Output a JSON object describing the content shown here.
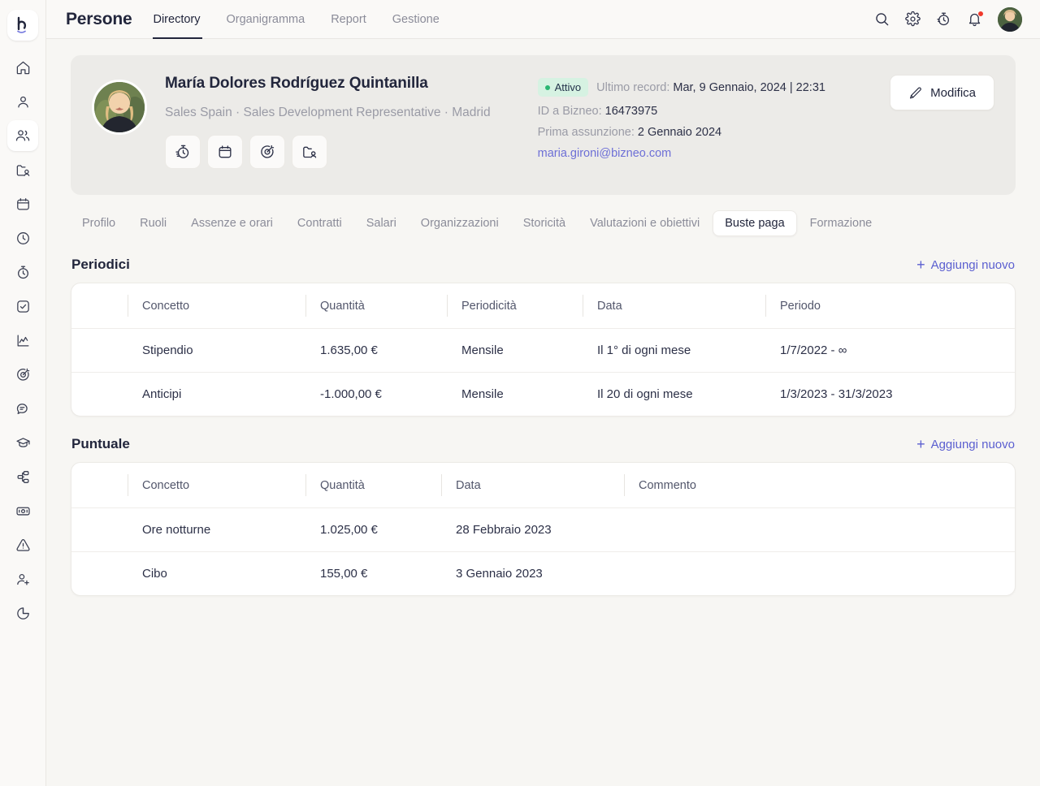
{
  "rail": {
    "logo": "bizneo-logo",
    "items": [
      {
        "name": "home-icon",
        "label": "Home",
        "active": false
      },
      {
        "name": "user-icon",
        "label": "Profilo",
        "active": false
      },
      {
        "name": "people-icon",
        "label": "Persone",
        "active": true
      },
      {
        "name": "folder-user-icon",
        "label": "Documenti",
        "active": false
      },
      {
        "name": "calendar-icon",
        "label": "Calendario",
        "active": false
      },
      {
        "name": "clock-icon",
        "label": "Orari",
        "active": false
      },
      {
        "name": "stopwatch-icon",
        "label": "Presenze",
        "active": false
      },
      {
        "name": "check-square-icon",
        "label": "Attivita",
        "active": false
      },
      {
        "name": "chart-line-icon",
        "label": "Analisi",
        "active": false
      },
      {
        "name": "target-icon",
        "label": "Obiettivi",
        "active": false
      },
      {
        "name": "chat-icon",
        "label": "Messaggi",
        "active": false
      },
      {
        "name": "graduation-cap-icon",
        "label": "Formazione",
        "active": false
      },
      {
        "name": "workflow-icon",
        "label": "Flussi",
        "active": false
      },
      {
        "name": "money-icon",
        "label": "Retribuzioni",
        "active": false
      },
      {
        "name": "alert-triangle-icon",
        "label": "Incidenti",
        "active": false
      },
      {
        "name": "user-plus-icon",
        "label": "Selezione",
        "active": false
      },
      {
        "name": "pie-chart-icon",
        "label": "Report",
        "active": false
      }
    ]
  },
  "header": {
    "app_title": "Persone",
    "nav": [
      {
        "label": "Directory",
        "active": true
      },
      {
        "label": "Organigramma",
        "active": false
      },
      {
        "label": "Report",
        "active": false
      },
      {
        "label": "Gestione",
        "active": false
      }
    ],
    "icons": [
      {
        "name": "search-icon"
      },
      {
        "name": "gear-icon"
      },
      {
        "name": "stopwatch-icon"
      },
      {
        "name": "bell-icon"
      }
    ],
    "avatar_alt": "Foto profilo utente"
  },
  "profile": {
    "name": "María Dolores Rodríguez Quintanilla",
    "subtitle": "Sales Spain · Sales Development Representative · Madrid",
    "avatar_alt": "Foto di María Dolores Rodríguez Quintanilla",
    "quick_actions": [
      {
        "name": "stopwatch-icon"
      },
      {
        "name": "calendar-icon"
      },
      {
        "name": "target-icon"
      },
      {
        "name": "folder-user-icon"
      }
    ],
    "status": "Attivo",
    "last_record_label": "Ultimo record:",
    "last_record_value": "Mar, 9 Gennaio, 2024 | 22:31",
    "bizneo_id_label": "ID a Bizneo:",
    "bizneo_id_value": "16473975",
    "first_hire_label": "Prima assunzione:",
    "first_hire_value": "2 Gennaio 2024",
    "email": "maria.gironi@bizneo.com",
    "edit_label": "Modifica"
  },
  "section_tabs": [
    {
      "label": "Profilo",
      "active": false
    },
    {
      "label": "Ruoli",
      "active": false
    },
    {
      "label": "Assenze e orari",
      "active": false
    },
    {
      "label": "Contratti",
      "active": false
    },
    {
      "label": "Salari",
      "active": false
    },
    {
      "label": "Organizzazioni",
      "active": false
    },
    {
      "label": "Storicità",
      "active": false
    },
    {
      "label": "Valutazioni e obiettivi",
      "active": false
    },
    {
      "label": "Buste paga",
      "active": true
    },
    {
      "label": "Formazione",
      "active": false
    }
  ],
  "periodici": {
    "title": "Periodici",
    "add_label": "Aggiungi nuovo",
    "columns": [
      "Concetto",
      "Quantità",
      "Periodicità",
      "Data",
      "Periodo"
    ],
    "rows": [
      {
        "concetto": "Stipendio",
        "quantita": "1.635,00 €",
        "periodicita": "Mensile",
        "data": "Il 1° di ogni mese",
        "periodo": "1/7/2022 - ∞"
      },
      {
        "concetto": "Anticipi",
        "quantita": "-1.000,00 €",
        "periodicita": "Mensile",
        "data": "Il 20 di ogni mese",
        "periodo": "1/3/2023 - 31/3/2023"
      }
    ]
  },
  "puntuale": {
    "title": "Puntuale",
    "add_label": "Aggiungi nuovo",
    "columns": [
      "Concetto",
      "Quantità",
      "Data",
      "Commento"
    ],
    "rows": [
      {
        "concetto": "Ore notturne",
        "quantita": "1.025,00 €",
        "data": "28 Febbraio 2023",
        "commento": ""
      },
      {
        "concetto": "Cibo",
        "quantita": "155,00 €",
        "data": "3 Gennaio 2023",
        "commento": ""
      }
    ]
  },
  "colors": {
    "background": "#f7f6f3",
    "card": "#ecebe8",
    "accent_link": "#5b5fd0",
    "status_green": "#2bb673",
    "status_bg": "#d6f2e2",
    "notification": "#f0392b"
  }
}
